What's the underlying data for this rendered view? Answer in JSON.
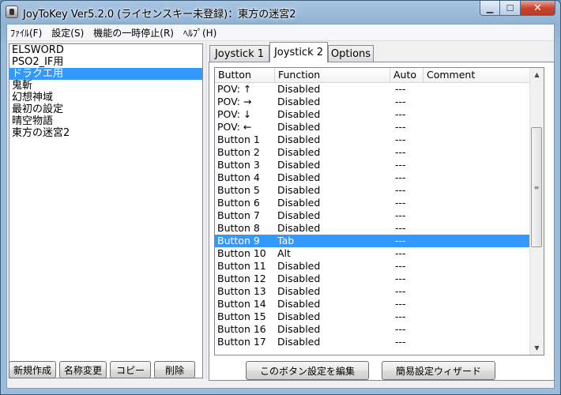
{
  "window": {
    "title": "JoyToKey Ver5.2.0 (ライセンスキー未登録)：東方の迷宮2"
  },
  "menu": [
    "ﾌｧｲﾙ(F)",
    "設定(S)",
    "機能の一時停止(R)",
    "ﾍﾙﾌﾟ(H)"
  ],
  "profiles": [
    {
      "label": "ELSWORD",
      "selected": false
    },
    {
      "label": "PSO2_IF用",
      "selected": false
    },
    {
      "label": "ドラクエ用",
      "selected": true
    },
    {
      "label": "鬼斬",
      "selected": false
    },
    {
      "label": "幻想神域",
      "selected": false
    },
    {
      "label": "最初の設定",
      "selected": false
    },
    {
      "label": "晴空物語",
      "selected": false
    },
    {
      "label": "東方の迷宮2",
      "selected": false
    }
  ],
  "profile_buttons": {
    "new": "新規作成",
    "rename": "名称変更",
    "copy": "コピー",
    "delete": "削除"
  },
  "tabs": [
    {
      "label": "Joystick 1",
      "active": false
    },
    {
      "label": "Joystick 2",
      "active": true
    },
    {
      "label": "Options",
      "active": false
    }
  ],
  "columns": {
    "button": "Button",
    "function": "Function",
    "auto": "Auto",
    "comment": "Comment"
  },
  "rows": [
    {
      "button": "POV: ↑",
      "function": "Disabled",
      "auto": "---",
      "comment": "",
      "selected": false
    },
    {
      "button": "POV: →",
      "function": "Disabled",
      "auto": "---",
      "comment": "",
      "selected": false
    },
    {
      "button": "POV: ↓",
      "function": "Disabled",
      "auto": "---",
      "comment": "",
      "selected": false
    },
    {
      "button": "POV: ←",
      "function": "Disabled",
      "auto": "---",
      "comment": "",
      "selected": false
    },
    {
      "button": "Button 1",
      "function": "Disabled",
      "auto": "---",
      "comment": "",
      "selected": false
    },
    {
      "button": "Button 2",
      "function": "Disabled",
      "auto": "---",
      "comment": "",
      "selected": false
    },
    {
      "button": "Button 3",
      "function": "Disabled",
      "auto": "---",
      "comment": "",
      "selected": false
    },
    {
      "button": "Button 4",
      "function": "Disabled",
      "auto": "---",
      "comment": "",
      "selected": false
    },
    {
      "button": "Button 5",
      "function": "Disabled",
      "auto": "---",
      "comment": "",
      "selected": false
    },
    {
      "button": "Button 6",
      "function": "Disabled",
      "auto": "---",
      "comment": "",
      "selected": false
    },
    {
      "button": "Button 7",
      "function": "Disabled",
      "auto": "---",
      "comment": "",
      "selected": false
    },
    {
      "button": "Button 8",
      "function": "Disabled",
      "auto": "---",
      "comment": "",
      "selected": false
    },
    {
      "button": "Button 9",
      "function": "Tab",
      "auto": "---",
      "comment": "",
      "selected": true
    },
    {
      "button": "Button 10",
      "function": "Alt",
      "auto": "---",
      "comment": "",
      "selected": false
    },
    {
      "button": "Button 11",
      "function": "Disabled",
      "auto": "---",
      "comment": "",
      "selected": false
    },
    {
      "button": "Button 12",
      "function": "Disabled",
      "auto": "---",
      "comment": "",
      "selected": false
    },
    {
      "button": "Button 13",
      "function": "Disabled",
      "auto": "---",
      "comment": "",
      "selected": false
    },
    {
      "button": "Button 14",
      "function": "Disabled",
      "auto": "---",
      "comment": "",
      "selected": false
    },
    {
      "button": "Button 15",
      "function": "Disabled",
      "auto": "---",
      "comment": "",
      "selected": false
    },
    {
      "button": "Button 16",
      "function": "Disabled",
      "auto": "---",
      "comment": "",
      "selected": false
    },
    {
      "button": "Button 17",
      "function": "Disabled",
      "auto": "---",
      "comment": "",
      "selected": false
    }
  ],
  "action_buttons": {
    "edit": "このボタン設定を編集",
    "wizard": "簡易設定ウィザード"
  },
  "icons": {
    "app": "joystick-icon",
    "minimize": "minimize-icon",
    "maximize": "maximize-icon",
    "close": "close-icon"
  },
  "colors": {
    "selection": "#3399ff"
  }
}
